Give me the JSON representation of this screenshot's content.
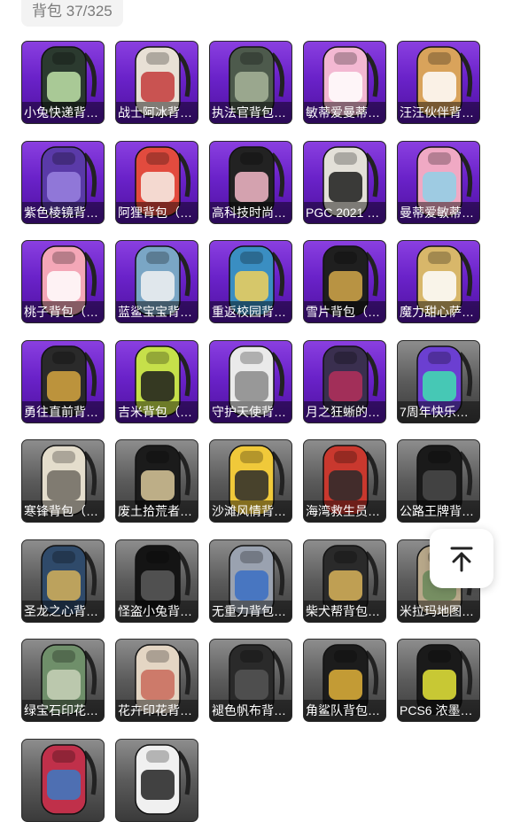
{
  "header": {
    "label": "背包",
    "count": "37/325"
  },
  "items": [
    {
      "name": "小兔快递背包（…",
      "rarity": "purple",
      "color": "#2b3a2f",
      "accent": "#bfe3a8"
    },
    {
      "name": "战士阿冰背包（…",
      "rarity": "purple",
      "color": "#e8e0d5",
      "accent": "#c33a3a"
    },
    {
      "name": "执法官背包（…",
      "rarity": "purple",
      "color": "#4d5a4c",
      "accent": "#a8b59a"
    },
    {
      "name": "敏蒂爱曼蒂背包…",
      "rarity": "purple",
      "color": "#f3b8d2",
      "accent": "#ffffff"
    },
    {
      "name": "汪汪伙伴背包（…",
      "rarity": "purple",
      "color": "#d9a35b",
      "accent": "#ffffff"
    },
    {
      "name": "紫色棱镜背包（…",
      "rarity": "purple",
      "color": "#5a3aa8",
      "accent": "#9a83e0"
    },
    {
      "name": "阿狸背包（…",
      "rarity": "purple",
      "color": "#e24b3e",
      "accent": "#f7f2ea"
    },
    {
      "name": "高科技时尚背包…",
      "rarity": "purple",
      "color": "#222222",
      "accent": "#f3b8c8"
    },
    {
      "name": "PGC 2021 背包…",
      "rarity": "purple",
      "color": "#e3e0d8",
      "accent": "#1c1c1c"
    },
    {
      "name": "曼蒂爱敏蒂背包…",
      "rarity": "purple",
      "color": "#f0a9c4",
      "accent": "#8fd1e8"
    },
    {
      "name": "桃子背包（…",
      "rarity": "purple",
      "color": "#f4a7b7",
      "accent": "#ffffff"
    },
    {
      "name": "蓝鲨宝宝背包（…",
      "rarity": "purple",
      "color": "#7aa6c5",
      "accent": "#f2f2f2"
    },
    {
      "name": "重返校园背包（…",
      "rarity": "purple",
      "color": "#3a8ec2",
      "accent": "#f2d15a"
    },
    {
      "name": "雪片背包（…",
      "rarity": "purple",
      "color": "#1f1f1f",
      "accent": "#d4a84a"
    },
    {
      "name": "魔力甜心萨背包…",
      "rarity": "purple",
      "color": "#d8b76a",
      "accent": "#ffffff"
    },
    {
      "name": "勇往直前背包（…",
      "rarity": "purple",
      "color": "#2a2a2a",
      "accent": "#d6a640"
    },
    {
      "name": "吉米背包（…",
      "rarity": "purple",
      "color": "#c6e04a",
      "accent": "#1b1b1b"
    },
    {
      "name": "守护天使背包（…",
      "rarity": "purple",
      "color": "#eaeaea",
      "accent": "#8a8a8a"
    },
    {
      "name": "月之狂蜥的背包…",
      "rarity": "purple",
      "color": "#3a2f4f",
      "accent": "#b52f5a"
    },
    {
      "name": "7周年快乐背包…",
      "rarity": "gray",
      "color": "#6b3fd1",
      "accent": "#3fe0b0"
    },
    {
      "name": "寒锋背包（…",
      "rarity": "gray",
      "color": "#e4ddcc",
      "accent": "#6e6a60"
    },
    {
      "name": "废土拾荒者背包…",
      "rarity": "gray",
      "color": "#1b1b1b",
      "accent": "#d9c89a"
    },
    {
      "name": "沙滩风情背包（…",
      "rarity": "gray",
      "color": "#f0c93a",
      "accent": "#2a2a2a"
    },
    {
      "name": "海湾救生员背包…",
      "rarity": "gray",
      "color": "#c9382e",
      "accent": "#2a2a2a"
    },
    {
      "name": "公路王牌背包（…",
      "rarity": "gray",
      "color": "#1a1a1a",
      "accent": "#4a4a4a"
    },
    {
      "name": "圣龙之心背包（…",
      "rarity": "gray",
      "color": "#2f4a6a",
      "accent": "#d5b25a"
    },
    {
      "name": "怪盗小兔背包（…",
      "rarity": "gray",
      "color": "#141414",
      "accent": "#5a5a5a"
    },
    {
      "name": "无重力背包（…",
      "rarity": "gray",
      "color": "#9aa2b0",
      "accent": "#3a6fc4"
    },
    {
      "name": "柴犬帮背包（…",
      "rarity": "gray",
      "color": "#2a2a2a",
      "accent": "#d9b45a"
    },
    {
      "name": "米拉玛地图背包…",
      "rarity": "gray",
      "color": "#b8a88a",
      "accent": "#6a8a5a"
    },
    {
      "name": "绿宝石印花背包…",
      "rarity": "gray",
      "color": "#6f8f6a",
      "accent": "#c9d2b8"
    },
    {
      "name": "花卉印花背包（…",
      "rarity": "gray",
      "color": "#e4d6c4",
      "accent": "#c96a5a"
    },
    {
      "name": "褪色帆布背包（…",
      "rarity": "gray",
      "color": "#2a2a2a",
      "accent": "#555555"
    },
    {
      "name": "角鲨队背包（…",
      "rarity": "gray",
      "color": "#1c1c1c",
      "accent": "#e0b23a"
    },
    {
      "name": "PCS6 浓墨背包…",
      "rarity": "gray",
      "color": "#1a1a1a",
      "accent": "#e8e83a"
    },
    {
      "name": "",
      "rarity": "gray",
      "color": "#c0304a",
      "accent": "#3a7ac4"
    },
    {
      "name": "",
      "rarity": "gray",
      "color": "#f0f0f0",
      "accent": "#222222"
    }
  ],
  "back_to_top": {
    "icon": "arrow-up-to-top-icon"
  }
}
